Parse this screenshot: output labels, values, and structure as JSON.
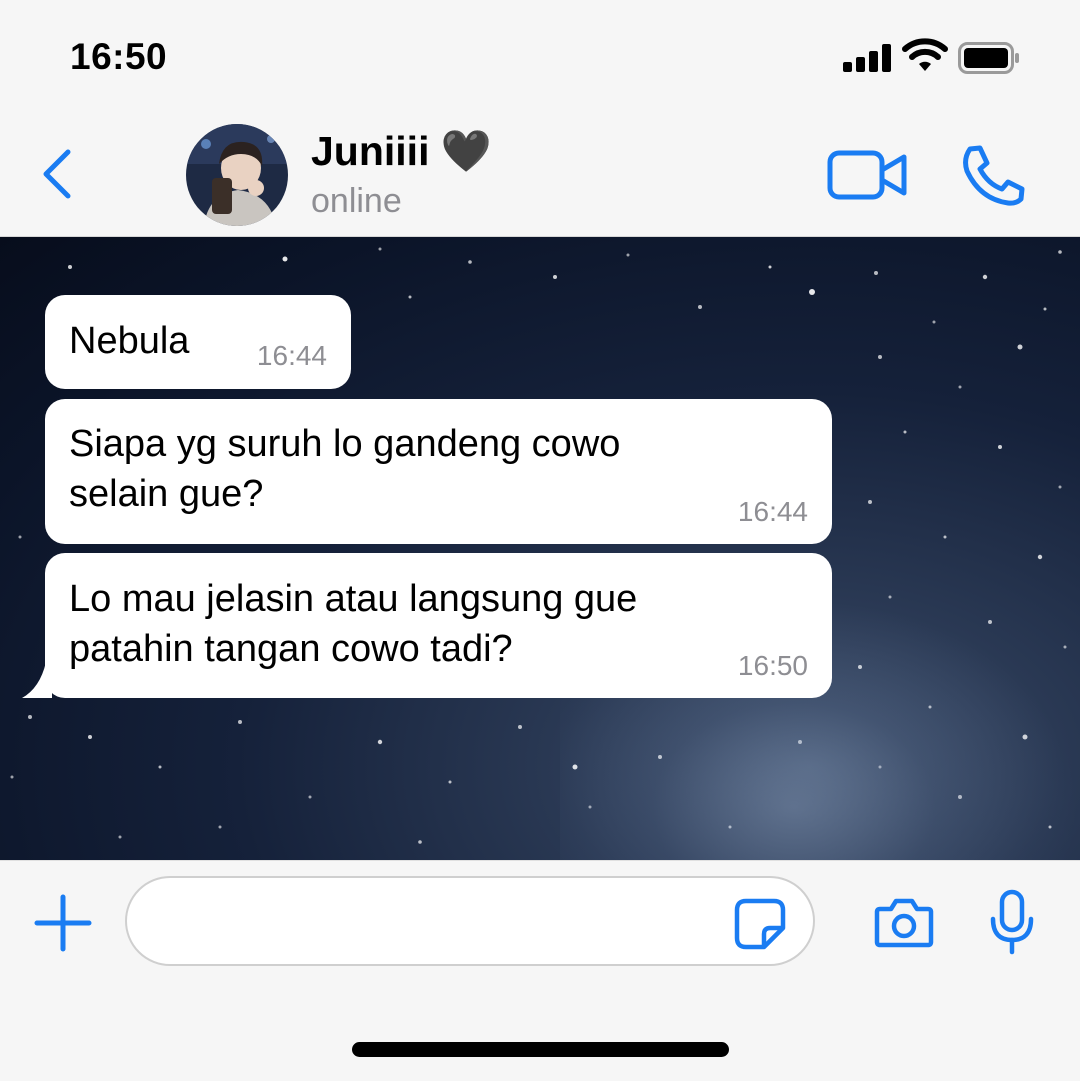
{
  "status_bar": {
    "time": "16:50"
  },
  "header": {
    "contact_name": "Juniiii 🖤",
    "contact_status": "online"
  },
  "messages": [
    {
      "text_lines": [
        "Nebula"
      ],
      "time": "16:44"
    },
    {
      "text_lines": [
        "Siapa yg suruh lo gandeng cowo",
        "selain gue?"
      ],
      "time": "16:44"
    },
    {
      "text_lines": [
        "Lo mau jelasin atau langsung gue",
        "patahin tangan cowo tadi?"
      ],
      "time": "16:50"
    }
  ],
  "composer": {
    "value": "",
    "placeholder": ""
  },
  "icons": {
    "back": "chevron-left-icon",
    "video": "video-camera-icon",
    "call": "phone-icon",
    "add": "plus-icon",
    "sticker": "sticker-icon",
    "camera": "camera-icon",
    "mic": "microphone-icon"
  },
  "colors": {
    "accent": "#1a7cf2",
    "bubble": "#ffffff",
    "timestamp": "#8e8e93"
  }
}
